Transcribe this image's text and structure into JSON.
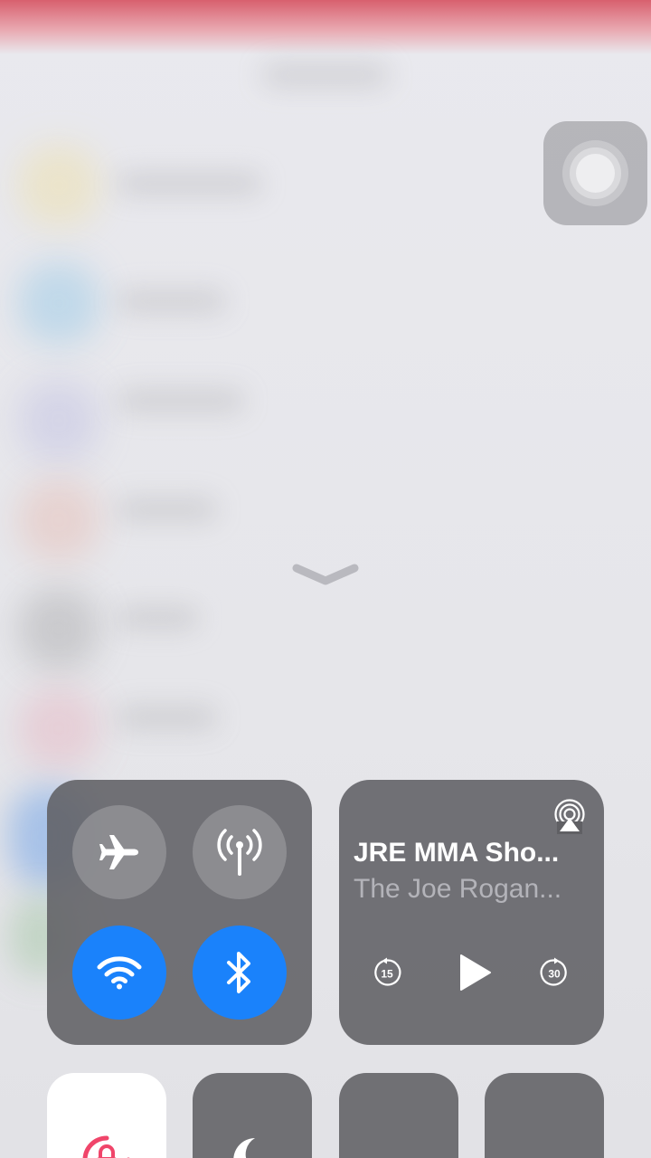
{
  "background": {
    "app": "blurred-app"
  },
  "assistive_touch": {
    "icon": "assistive-touch-icon"
  },
  "dismiss": {
    "icon": "chevron-down-icon"
  },
  "connectivity": {
    "airplane_mode": {
      "icon": "airplane-icon",
      "enabled": false
    },
    "cellular_data": {
      "icon": "cellular-antenna-icon",
      "enabled": false
    },
    "wifi": {
      "icon": "wifi-icon",
      "enabled": true
    },
    "bluetooth": {
      "icon": "bluetooth-icon",
      "enabled": true
    },
    "colors": {
      "on": "#1a82fb",
      "off": "#96969a"
    }
  },
  "now_playing": {
    "title": "JRE MMA Sho...",
    "subtitle": "The Joe Rogan...",
    "airplay_icon": "airplay-audio-icon",
    "skip_back_label": "15",
    "skip_forward_label": "30",
    "play_icon": "play-icon"
  },
  "controls": {
    "rotation_lock": {
      "icon": "rotation-lock-icon",
      "enabled": true,
      "color": "#f0456a"
    },
    "do_not_disturb": {
      "icon": "moon-icon",
      "enabled": false
    }
  }
}
